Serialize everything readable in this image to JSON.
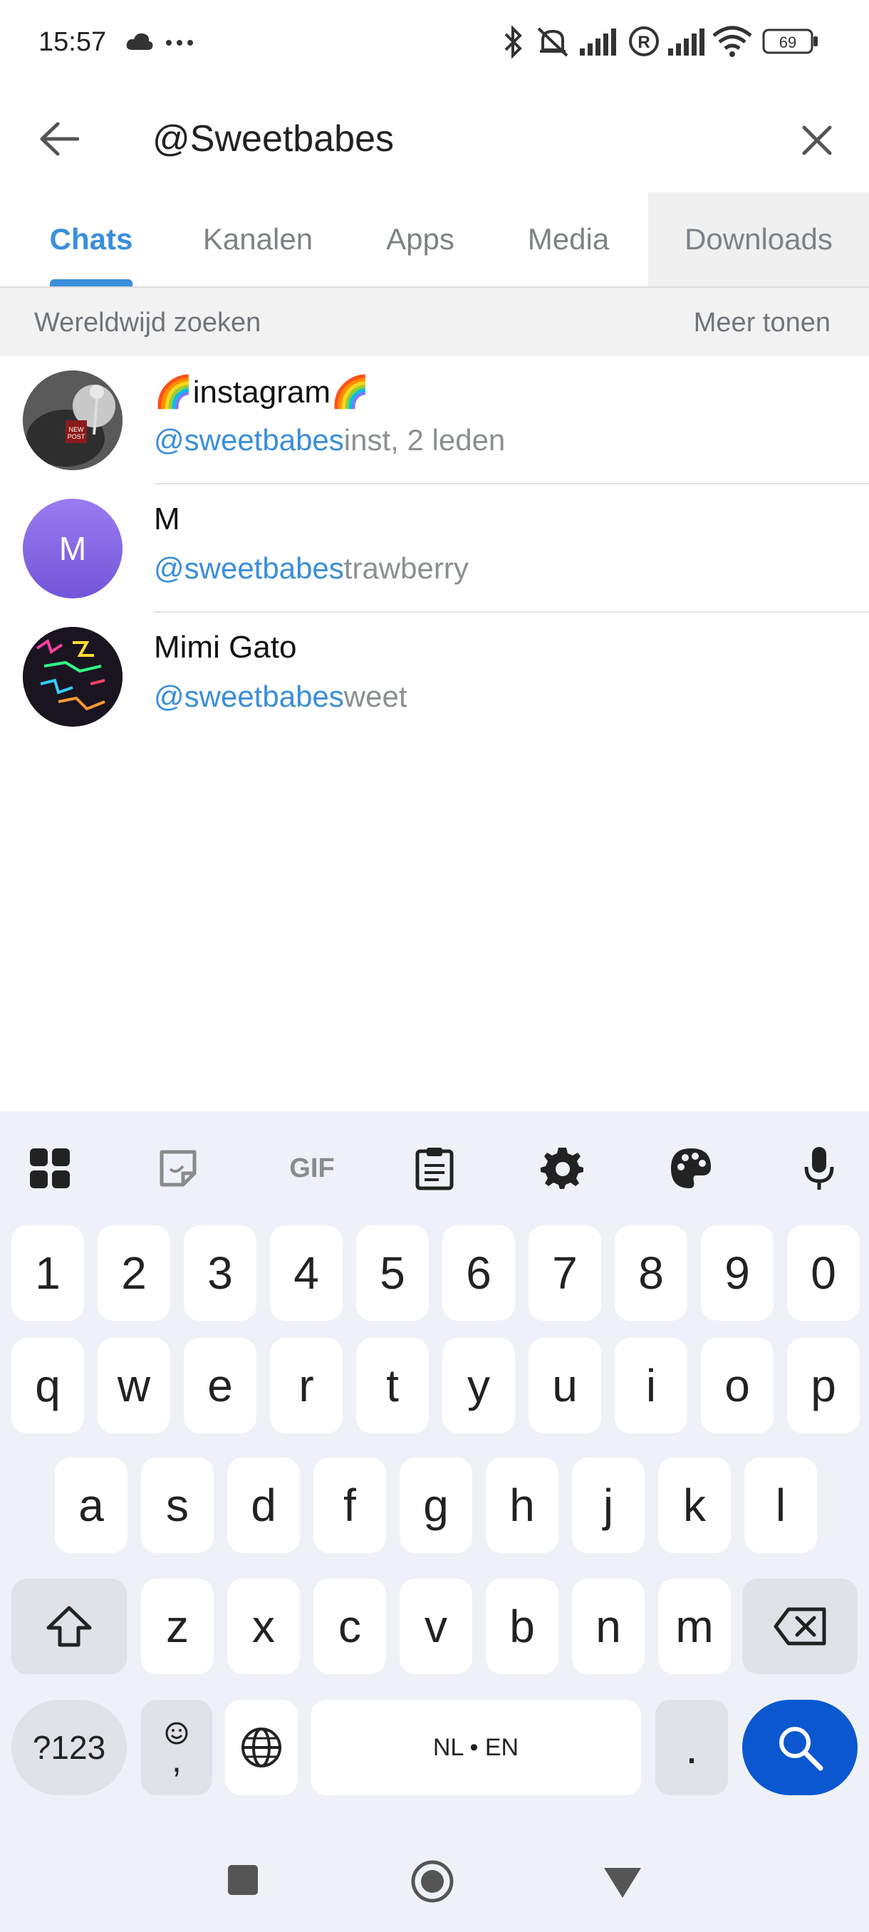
{
  "status_bar": {
    "time": "15:57",
    "battery": "69",
    "icons": [
      "cloud-icon",
      "more-dots-icon",
      "bluetooth-icon",
      "mute-icon",
      "signal-icon",
      "registered-icon",
      "signal-icon-2",
      "wifi-icon",
      "battery-icon"
    ]
  },
  "search": {
    "value": "@Sweetbabes",
    "back_icon": "arrow-left-icon",
    "clear_icon": "close-icon"
  },
  "tabs": [
    {
      "label": "Chats",
      "active": true
    },
    {
      "label": "Kanalen",
      "active": false
    },
    {
      "label": "Apps",
      "active": false
    },
    {
      "label": "Media",
      "active": false
    },
    {
      "label": "Downloads",
      "active": false
    }
  ],
  "section": {
    "title": "Wereldwijd zoeken",
    "more": "Meer tonen"
  },
  "results": [
    {
      "name": "🌈instagram🌈",
      "handle_match": "@sweetbabes",
      "handle_rest": "inst, 2 leden",
      "avatar": "photo"
    },
    {
      "name": "M",
      "handle_match": "@sweetbabes",
      "handle_rest": "trawberry",
      "avatar_letter": "M",
      "avatar_color": "#8b6ce6"
    },
    {
      "name": "Mimi Gato",
      "handle_match": "@sweetbabes",
      "handle_rest": "weet",
      "avatar": "neon-photo"
    }
  ],
  "keyboard": {
    "toolbar": [
      "apps-grid-icon",
      "sticker-icon",
      "gif-icon",
      "clipboard-icon",
      "settings-icon",
      "palette-icon",
      "microphone-icon"
    ],
    "gif_label": "GIF",
    "row_numbers": [
      "1",
      "2",
      "3",
      "4",
      "5",
      "6",
      "7",
      "8",
      "9",
      "0"
    ],
    "row1": [
      "q",
      "w",
      "e",
      "r",
      "t",
      "y",
      "u",
      "i",
      "o",
      "p"
    ],
    "row2": [
      "a",
      "s",
      "d",
      "f",
      "g",
      "h",
      "j",
      "k",
      "l"
    ],
    "row3": [
      "z",
      "x",
      "c",
      "v",
      "b",
      "n",
      "m"
    ],
    "symbols_label": "?123",
    "emoji_comma_label": ",",
    "space_label": "NL • EN",
    "period_label": "."
  },
  "colors": {
    "accent": "#3a8edb",
    "keyboard_bg": "#eef1f7",
    "search_key": "#0b57d0"
  }
}
